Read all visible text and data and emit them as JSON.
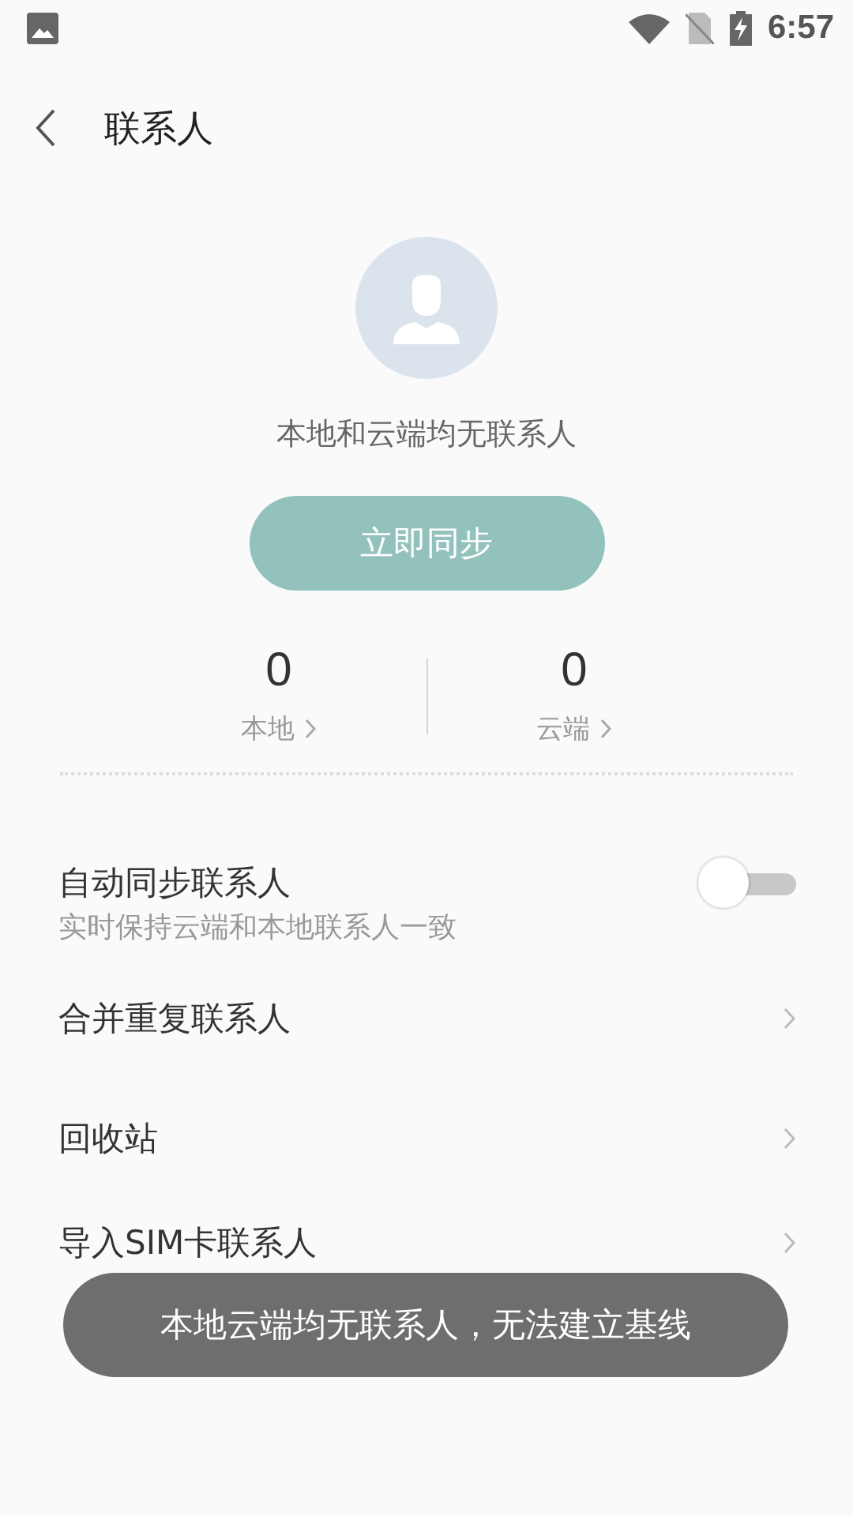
{
  "status_bar": {
    "time": "6:57"
  },
  "header": {
    "title": "联系人"
  },
  "empty_state": {
    "message": "本地和云端均无联系人"
  },
  "sync_button": {
    "label": "立即同步"
  },
  "stats": [
    {
      "count": "0",
      "label": "本地"
    },
    {
      "count": "0",
      "label": "云端"
    }
  ],
  "settings": [
    {
      "kind": "toggle",
      "title": "自动同步联系人",
      "subtitle": "实时保持云端和本地联系人一致",
      "on": false
    },
    {
      "kind": "link",
      "title": "合并重复联系人"
    },
    {
      "kind": "link",
      "title": "回收站"
    },
    {
      "kind": "link",
      "title": "导入SIM卡联系人"
    }
  ],
  "toast": {
    "message": "本地云端均无联系人，无法建立基线"
  }
}
